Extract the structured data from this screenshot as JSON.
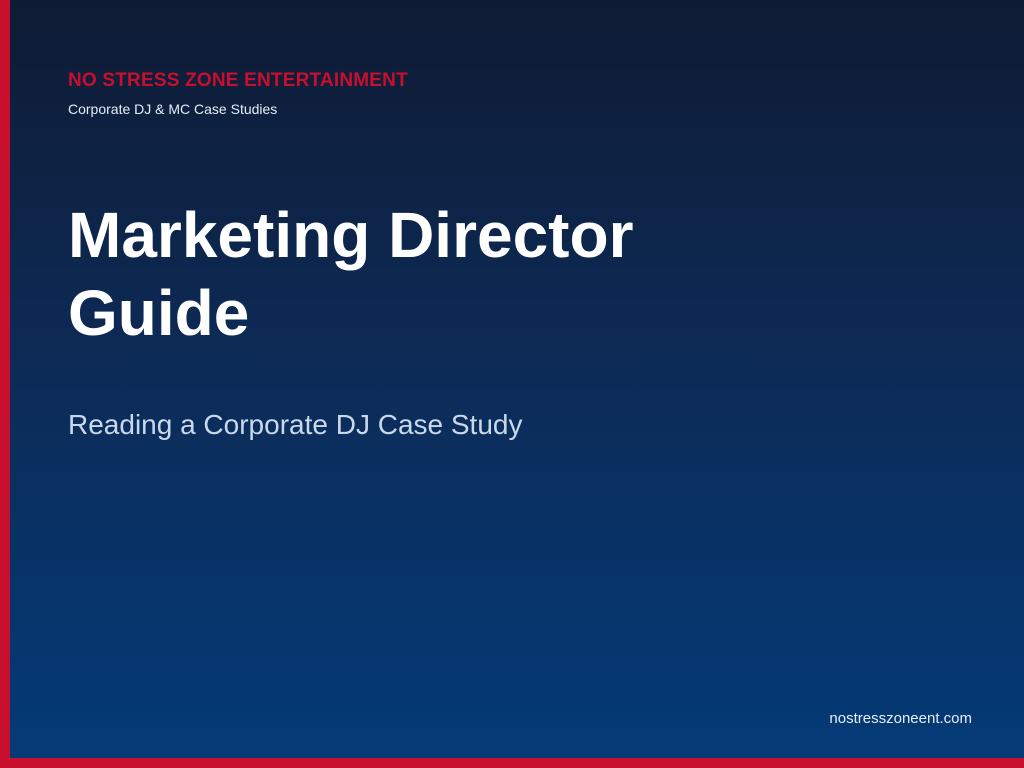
{
  "slide": {
    "brand": "NO STRESS ZONE ENTERTAINMENT",
    "brand_subtitle": "Corporate DJ & MC Case Studies",
    "title_lines": [
      "Marketing Director",
      "Guide"
    ],
    "subtitle": "Reading a Corporate DJ Case Study",
    "website": "nostresszoneent.com"
  },
  "colors": {
    "accent": "#c8102e",
    "title_text": "#ffffff",
    "subtitle_text": "#c9d8ec",
    "secondary_text": "#e6edf7"
  }
}
